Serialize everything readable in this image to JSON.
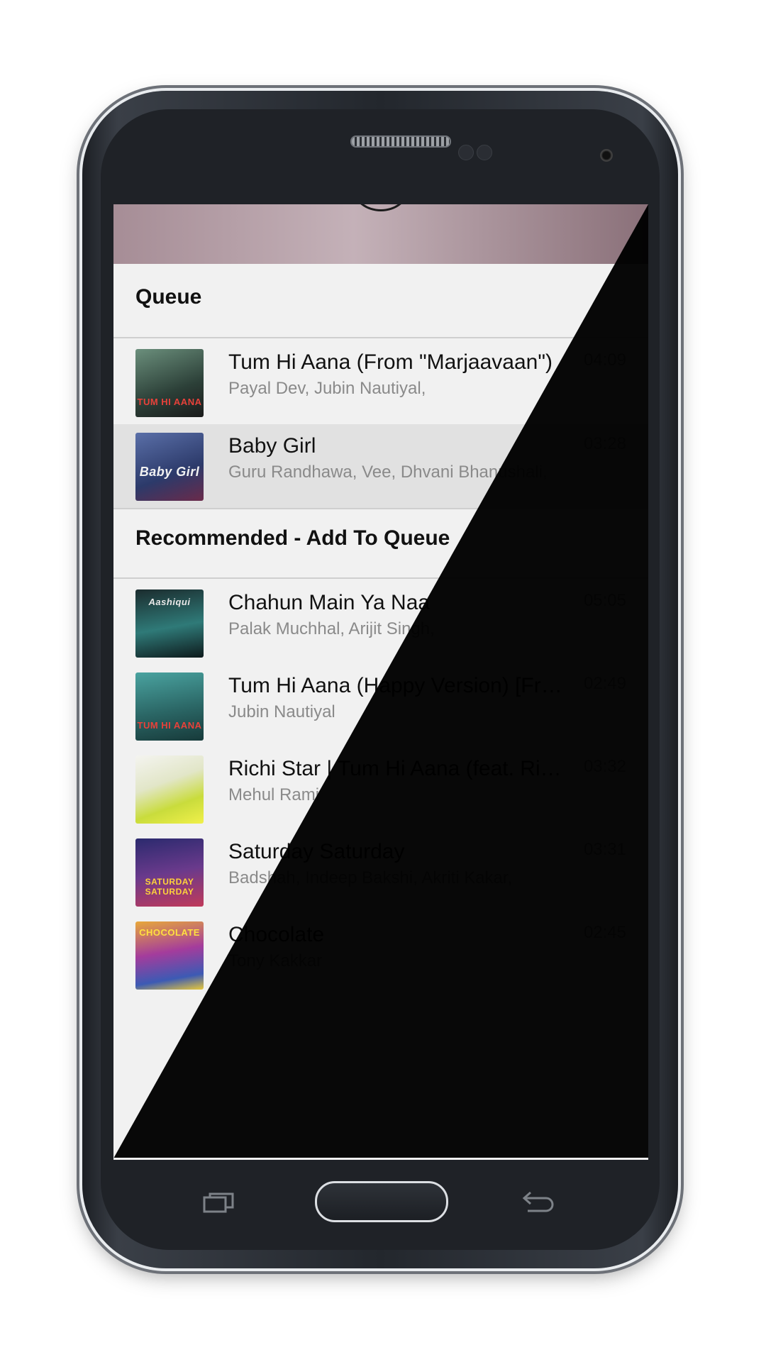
{
  "queue": {
    "header": "Queue",
    "songs": [
      {
        "title": "Tum Hi Aana (From \"Marjaavaan\")",
        "artist": "Payal Dev, Jubin Nautiyal,",
        "duration": "04:09",
        "cover_text": "TUM HI AANA",
        "cover_color": "#3d5a4c"
      },
      {
        "title": "Baby Girl",
        "artist": "Guru Randhawa, Vee, Dhvani Bhanushali,",
        "duration": "03:28",
        "cover_text": "Baby Girl",
        "cover_color": "#3c4e7a"
      }
    ]
  },
  "recommended": {
    "header": "Recommended - Add To Queue",
    "songs": [
      {
        "title": "Chahun Main Ya Naa",
        "artist": "Palak Muchhal, Arijit Singh,",
        "duration": "05:05",
        "cover_text": "Aashiqui",
        "cover_color": "#1e4e4f"
      },
      {
        "title": "Tum Hi Aana (Happy Version) [Fro…",
        "artist": "Jubin Nautiyal",
        "duration": "02:49",
        "cover_text": "TUM HI AANA",
        "cover_color": "#2f6d6b"
      },
      {
        "title": "Richi Star | Tum Hi Aana (feat. Rich…",
        "artist": "Mehul Rami",
        "duration": "03:32",
        "cover_text": "",
        "cover_color": "#c8d84c"
      },
      {
        "title": "Saturday Saturday",
        "artist": "Badshah, Indeep Bakshi, Akriti Kakar,",
        "duration": "03:31",
        "cover_text": "SATURDAY SATURDAY",
        "cover_color": "#3a2d6e"
      },
      {
        "title": "Chocolate",
        "artist": "Tony Kakkar",
        "duration": "02:45",
        "cover_text": "CHOCOLATE",
        "cover_color": "#8a3c9a"
      }
    ]
  }
}
